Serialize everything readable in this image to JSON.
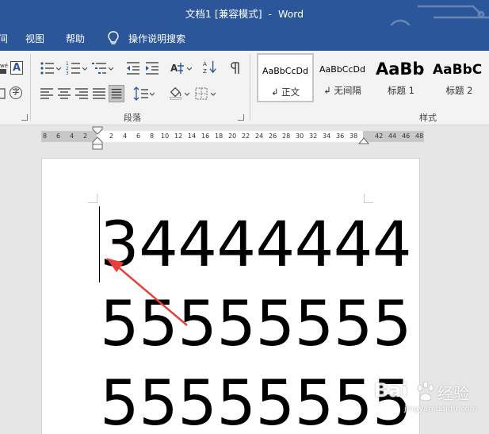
{
  "window": {
    "title": "文档1 [兼容模式]  -  Word"
  },
  "menu": {
    "items": [
      "间",
      "视图",
      "帮助"
    ],
    "tell_me": "操作说明搜索"
  },
  "ribbon": {
    "groups": {
      "paragraph": "段落",
      "styles": "样式"
    },
    "font_partial": {
      "phonetic": "wén",
      "char_border": "A",
      "enclose": "字"
    },
    "styles_gallery": [
      {
        "sample": "AaBbCcDd",
        "name": "↲ 正文"
      },
      {
        "sample": "AaBbCcDd",
        "name": "↲ 无间隔"
      },
      {
        "sample": "AaBb",
        "name": "标题 1"
      },
      {
        "sample": "AaBbC",
        "name": "标题 2"
      }
    ]
  },
  "ruler": {
    "left_ticks": [
      "8",
      "6",
      "4",
      "2"
    ],
    "main_ticks": [
      "2",
      "4",
      "6",
      "8",
      "10",
      "12",
      "14",
      "16",
      "18",
      "20",
      "22",
      "24",
      "26",
      "28",
      "30",
      "32",
      "34",
      "36",
      "38"
    ],
    "right_ticks": [
      "42",
      "44",
      "46",
      "48"
    ]
  },
  "document": {
    "lines": [
      "34444444",
      "55555555",
      "55555555"
    ]
  },
  "watermark": {
    "brand": "Bai",
    "brand_cn": "经验",
    "url": "jingyan.baidu.com"
  },
  "colors": {
    "titlebar": "#2b579a",
    "annotation_arrow": "#e8403a"
  }
}
